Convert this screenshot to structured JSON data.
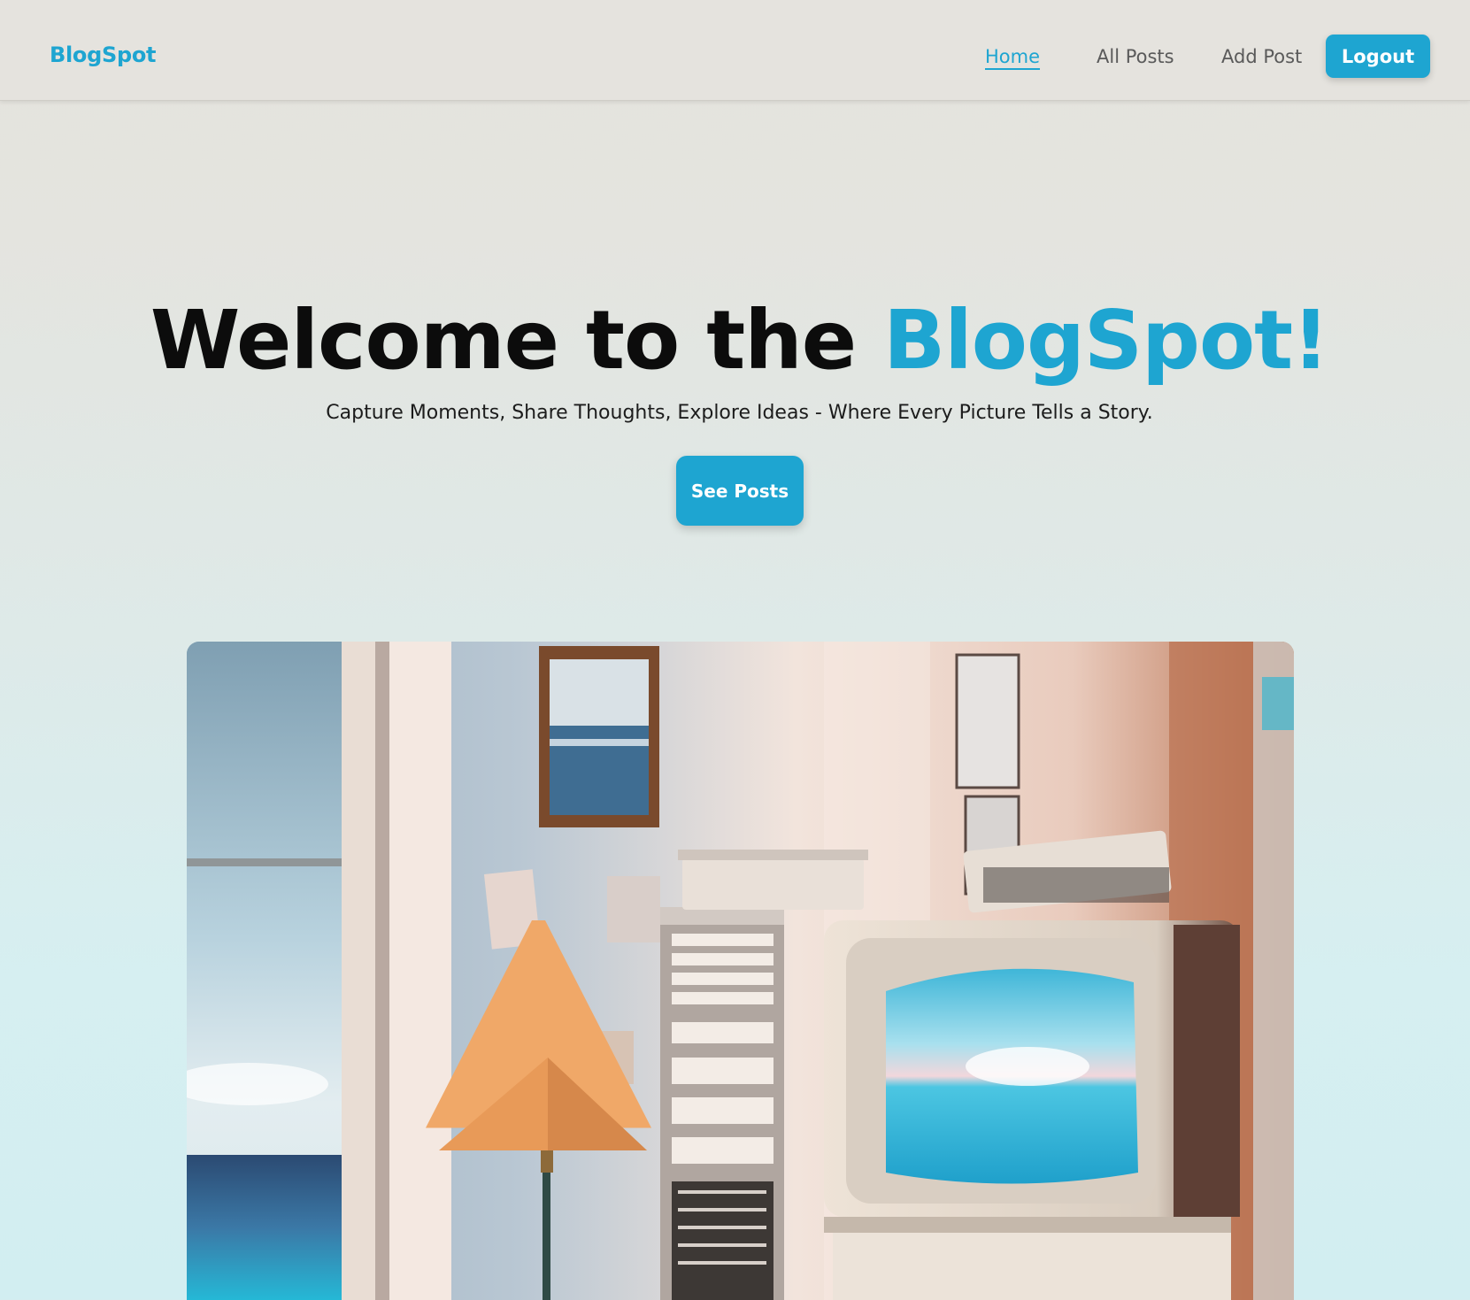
{
  "nav": {
    "brand": "BlogSpot",
    "links": [
      {
        "label": "Home",
        "active": true
      },
      {
        "label": "All Posts",
        "active": false
      },
      {
        "label": "Add Post",
        "active": false
      }
    ],
    "logout_label": "Logout"
  },
  "hero": {
    "title_prefix": "Welcome to the ",
    "title_accent": "BlogSpot!",
    "subtitle": "Capture Moments, Share Thoughts, Explore Ideas - Where Every Picture Tells a Story.",
    "cta_label": "See Posts"
  },
  "colors": {
    "accent": "#1ea5d1",
    "navbar_bg": "#e5e3de",
    "text_dark": "#0c0c0c"
  }
}
